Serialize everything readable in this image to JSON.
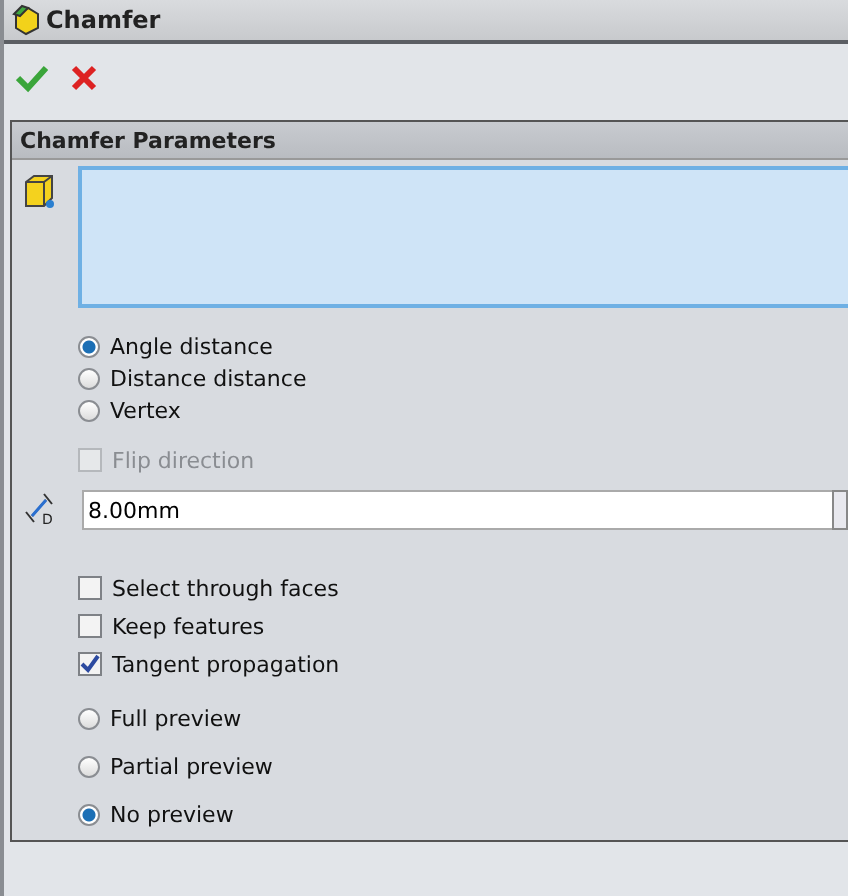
{
  "window": {
    "title": "Chamfer"
  },
  "panel": {
    "title": "Chamfer Parameters",
    "chamfer_types": [
      {
        "label": "Angle distance",
        "selected": true
      },
      {
        "label": "Distance distance",
        "selected": false
      },
      {
        "label": "Vertex",
        "selected": false
      }
    ],
    "flip_direction": {
      "label": "Flip direction",
      "checked": false,
      "disabled": true
    },
    "distance": {
      "icon_label": "D",
      "value": "8.00mm"
    },
    "options": [
      {
        "label": "Select through faces",
        "checked": false
      },
      {
        "label": "Keep features",
        "checked": false
      },
      {
        "label": "Tangent propagation",
        "checked": true
      }
    ],
    "previews": [
      {
        "label": "Full preview",
        "selected": false
      },
      {
        "label": "Partial preview",
        "selected": false
      },
      {
        "label": "No preview",
        "selected": true
      }
    ]
  }
}
